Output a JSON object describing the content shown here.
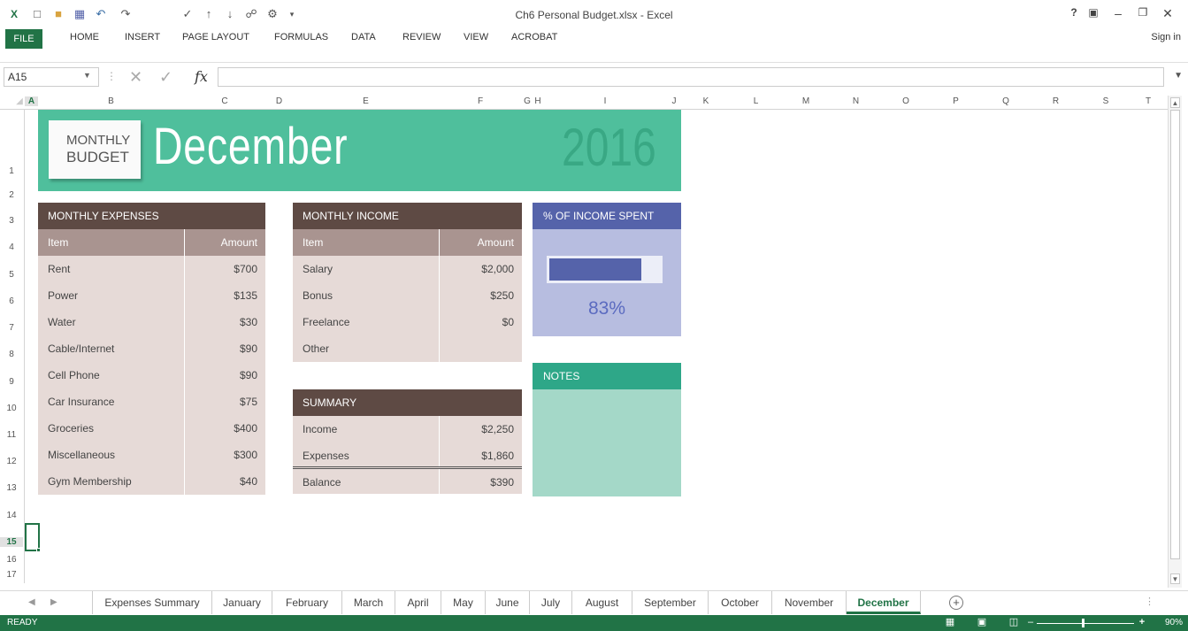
{
  "window": {
    "title": "Ch6 Personal Budget.xlsx - Excel",
    "help": "?",
    "sign_in": "Sign in"
  },
  "ribbon": {
    "tabs": [
      "FILE",
      "HOME",
      "INSERT",
      "PAGE LAYOUT",
      "FORMULAS",
      "DATA",
      "REVIEW",
      "VIEW",
      "ACROBAT"
    ]
  },
  "formula_bar": {
    "name_box": "A15",
    "fx": "fx",
    "formula": ""
  },
  "grid": {
    "columns": [
      "A",
      "B",
      "C",
      "D",
      "E",
      "F",
      "G",
      "H",
      "I",
      "J",
      "K",
      "L",
      "M",
      "N",
      "O",
      "P",
      "Q",
      "R",
      "S",
      "T"
    ],
    "rows": [
      "1",
      "2",
      "3",
      "4",
      "5",
      "6",
      "7",
      "8",
      "9",
      "10",
      "11",
      "12",
      "13",
      "14",
      "15",
      "16",
      "17"
    ],
    "selected_cell": "A15"
  },
  "banner": {
    "badge_line1": "MONTHLY",
    "badge_line2": "BUDGET",
    "month": "December",
    "year": "2016"
  },
  "expenses": {
    "title": "MONTHLY EXPENSES",
    "col_item": "Item",
    "col_amount": "Amount",
    "rows": [
      {
        "item": "Rent",
        "amount": "$700"
      },
      {
        "item": "Power",
        "amount": "$135"
      },
      {
        "item": "Water",
        "amount": "$30"
      },
      {
        "item": "Cable/Internet",
        "amount": "$90"
      },
      {
        "item": "Cell Phone",
        "amount": "$90"
      },
      {
        "item": "Car Insurance",
        "amount": "$75"
      },
      {
        "item": "Groceries",
        "amount": "$400"
      },
      {
        "item": "Miscellaneous",
        "amount": "$300"
      },
      {
        "item": "Gym Membership",
        "amount": "$40"
      }
    ]
  },
  "income": {
    "title": "MONTHLY INCOME",
    "col_item": "Item",
    "col_amount": "Amount",
    "rows": [
      {
        "item": "Salary",
        "amount": "$2,000"
      },
      {
        "item": "Bonus",
        "amount": "$250"
      },
      {
        "item": "Freelance",
        "amount": "$0"
      },
      {
        "item": "Other",
        "amount": ""
      }
    ]
  },
  "summary": {
    "title": "SUMMARY",
    "rows": [
      {
        "item": "Income",
        "amount": "$2,250"
      },
      {
        "item": "Expenses",
        "amount": "$1,860"
      },
      {
        "item": "Balance",
        "amount": "$390"
      }
    ]
  },
  "percent_spent": {
    "title": "% OF INCOME SPENT",
    "value_text": "83%",
    "fraction": 0.83
  },
  "notes": {
    "title": "NOTES"
  },
  "sheets": {
    "tabs": [
      "Expenses Summary",
      "January",
      "February",
      "March",
      "April",
      "May",
      "June",
      "July",
      "August",
      "September",
      "October",
      "November",
      "December"
    ],
    "active": "December"
  },
  "status": {
    "text": "READY",
    "zoom": "90%"
  },
  "colors": {
    "excel_green": "#217346",
    "banner_teal": "#4fbf9c",
    "table_header_brown": "#5e4a44",
    "table_col_header": "#a99490",
    "table_row": "#e6dad7",
    "percent_blue": "#5563aa",
    "notes_teal": "#2ea788"
  }
}
